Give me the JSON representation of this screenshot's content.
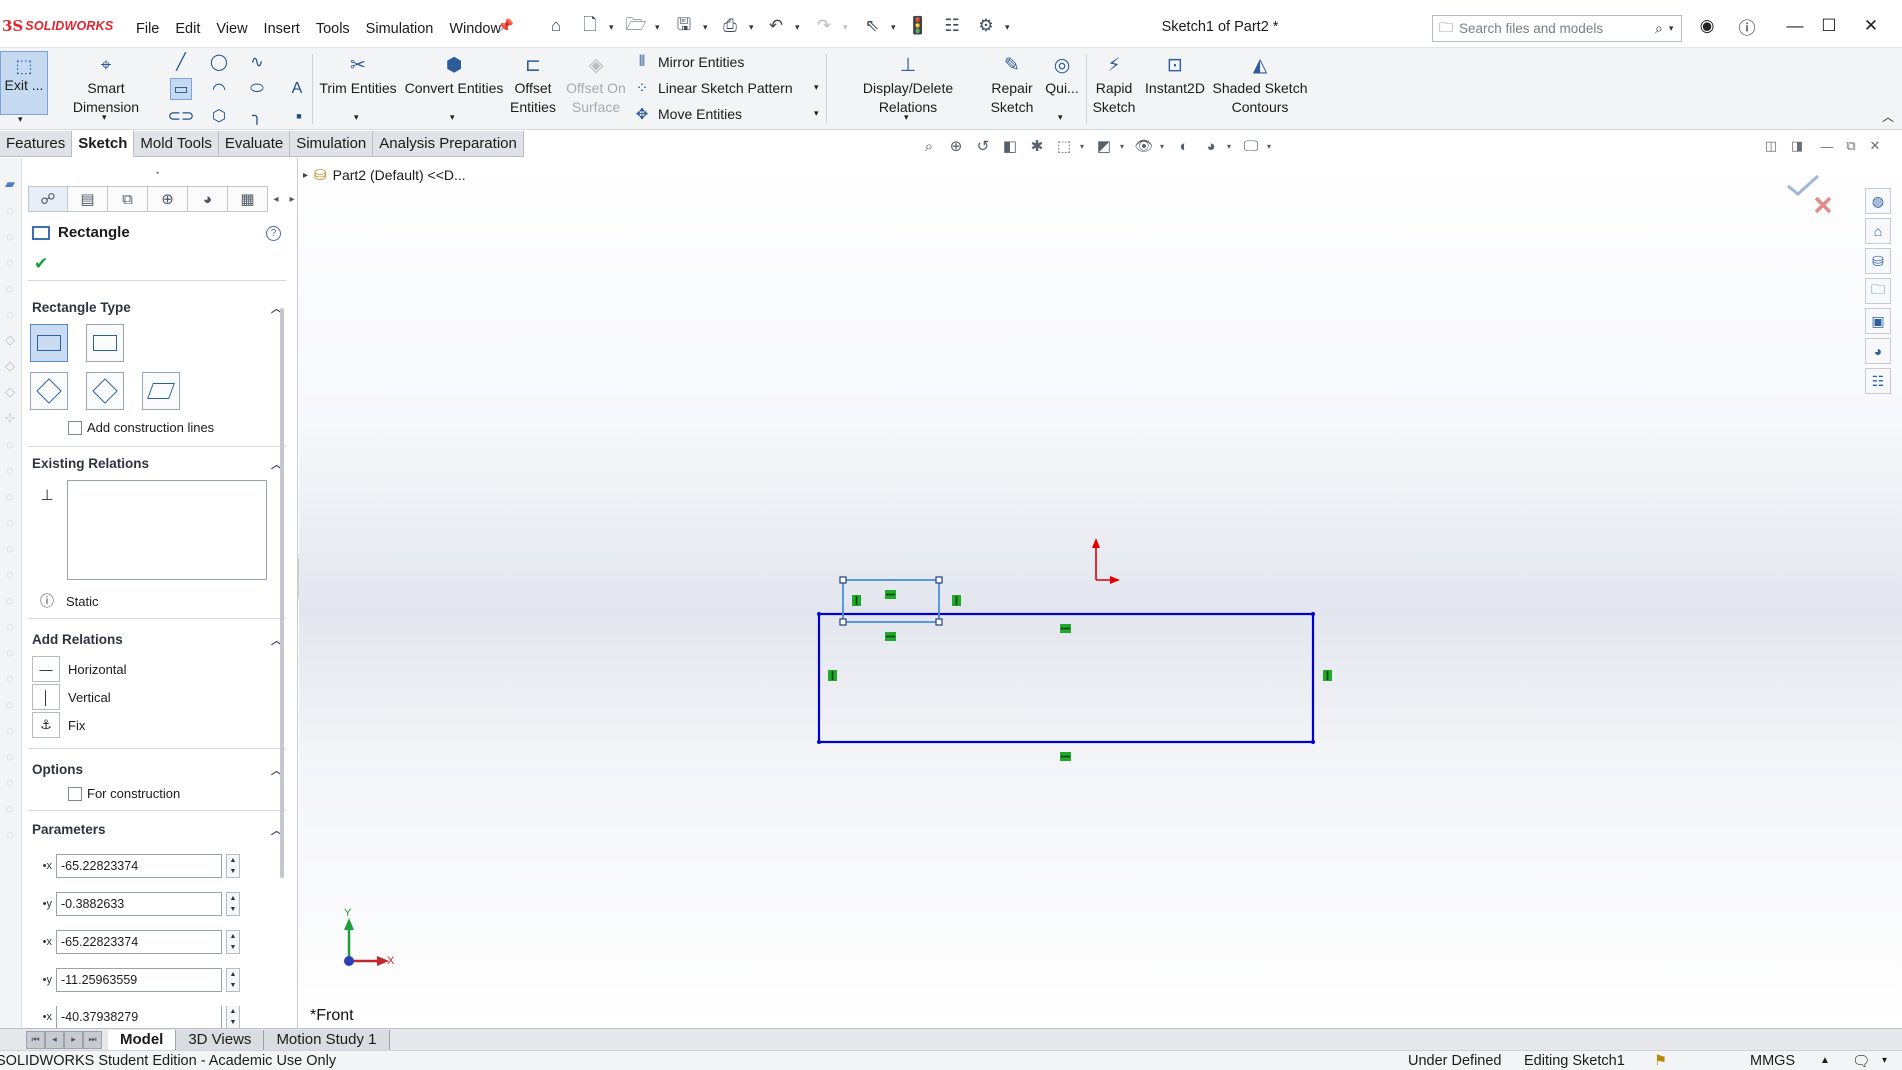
{
  "app": {
    "logo_mark": "3S",
    "logo_text": "SOLIDWORKS",
    "document_title": "Sketch1 of Part2 *"
  },
  "menu": [
    "File",
    "Edit",
    "View",
    "Insert",
    "Tools",
    "Simulation",
    "Window"
  ],
  "search": {
    "placeholder": "Search files and models"
  },
  "ribbon": {
    "exit_label": "Exit ...",
    "smart_dimension": "Smart Dimension",
    "trim_entities": "Trim Entities",
    "convert_entities": "Convert Entities",
    "offset_entities_1": "Offset",
    "offset_entities_2": "Entities",
    "offset_on_surface_1": "Offset On",
    "offset_on_surface_2": "Surface",
    "mirror_entities": "Mirror Entities",
    "linear_sketch_pattern": "Linear Sketch Pattern",
    "move_entities": "Move Entities",
    "display_delete_relations": "Display/Delete Relations",
    "repair_sketch_1": "Repair",
    "repair_sketch_2": "Sketch",
    "quick_snaps": "Qui...",
    "rapid_sketch_1": "Rapid",
    "rapid_sketch_2": "Sketch",
    "instant2d": "Instant2D",
    "shaded_contours_1": "Shaded Sketch",
    "shaded_contours_2": "Contours"
  },
  "command_tabs": [
    {
      "label": "Features",
      "active": false
    },
    {
      "label": "Sketch",
      "active": true
    },
    {
      "label": "Mold Tools",
      "active": false
    },
    {
      "label": "Evaluate",
      "active": false
    },
    {
      "label": "Simulation",
      "active": false
    },
    {
      "label": "Analysis Preparation",
      "active": false
    }
  ],
  "feature_tree_flyout": "Part2 (Default) <<D...",
  "property_manager": {
    "title": "Rectangle",
    "rectangle_type": {
      "header": "Rectangle Type",
      "selected": "corner-rectangle",
      "add_construction_lines": "Add construction lines"
    },
    "existing_relations": {
      "header": "Existing Relations",
      "status": "Static"
    },
    "add_relations": {
      "header": "Add Relations",
      "items": [
        "Horizontal",
        "Vertical",
        "Fix"
      ]
    },
    "options": {
      "header": "Options",
      "for_construction": "For construction"
    },
    "parameters": {
      "header": "Parameters",
      "values": [
        "-65.22823374",
        "-0.3882633",
        "-65.22823374",
        "-11.25963559",
        "-40.37938279"
      ]
    }
  },
  "graphics": {
    "view_name": "*Front",
    "triad_y": "Y",
    "triad_x": "X",
    "sketch_color": "#0000d0",
    "relation_color": "#1faa2a",
    "origin_color": "#e00000"
  },
  "bottom_tabs": [
    {
      "label": "Model",
      "active": true
    },
    {
      "label": "3D Views",
      "active": false
    },
    {
      "label": "Motion Study 1",
      "active": false
    }
  ],
  "status_bar": {
    "edition": "SOLIDWORKS Student Edition - Academic Use Only",
    "sketch_state": "Under Defined",
    "editing": "Editing Sketch1",
    "units": "MMGS"
  }
}
